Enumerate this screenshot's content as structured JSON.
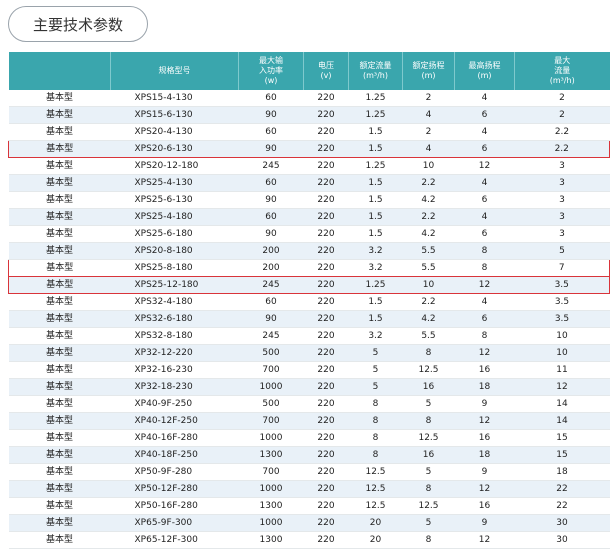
{
  "section_title": "主要技术参数",
  "table": {
    "headers": [
      "",
      "规格型号",
      "最大输入功率(w)",
      "电压(v)",
      "额定流量(m³/h)",
      "额定扬程(m)",
      "最高扬程(m)",
      "最大流量(m³/h)"
    ],
    "header_lines": [
      [
        ""
      ],
      [
        "规格型号"
      ],
      [
        "最大输",
        "入功率",
        "(w)"
      ],
      [
        "电压",
        "(v)"
      ],
      [
        "额定流量",
        "(m³/h)"
      ],
      [
        "额定扬程",
        "(m)"
      ],
      [
        "最高扬程",
        "(m)"
      ],
      [
        "最大",
        "流量",
        "(m³/h)"
      ]
    ],
    "highlight_color": "#d9343a",
    "rows": [
      {
        "cells": [
          "基本型",
          "XPS15-4-130",
          "60",
          "220",
          "1.25",
          "2",
          "4",
          "2"
        ],
        "highlight": false
      },
      {
        "cells": [
          "基本型",
          "XPS15-6-130",
          "90",
          "220",
          "1.25",
          "4",
          "6",
          "2"
        ],
        "highlight": false
      },
      {
        "cells": [
          "基本型",
          "XPS20-4-130",
          "60",
          "220",
          "1.5",
          "2",
          "4",
          "2.2"
        ],
        "highlight": false
      },
      {
        "cells": [
          "基本型",
          "XPS20-6-130",
          "90",
          "220",
          "1.5",
          "4",
          "6",
          "2.2"
        ],
        "highlight": true
      },
      {
        "cells": [
          "基本型",
          "XPS20-12-180",
          "245",
          "220",
          "1.25",
          "10",
          "12",
          "3"
        ],
        "highlight": false
      },
      {
        "cells": [
          "基本型",
          "XPS25-4-130",
          "60",
          "220",
          "1.5",
          "2.2",
          "4",
          "3"
        ],
        "highlight": false
      },
      {
        "cells": [
          "基本型",
          "XPS25-6-130",
          "90",
          "220",
          "1.5",
          "4.2",
          "6",
          "3"
        ],
        "highlight": false
      },
      {
        "cells": [
          "基本型",
          "XPS25-4-180",
          "60",
          "220",
          "1.5",
          "2.2",
          "4",
          "3"
        ],
        "highlight": false
      },
      {
        "cells": [
          "基本型",
          "XPS25-6-180",
          "90",
          "220",
          "1.5",
          "4.2",
          "6",
          "3"
        ],
        "highlight": false
      },
      {
        "cells": [
          "基本型",
          "XPS20-8-180",
          "200",
          "220",
          "3.2",
          "5.5",
          "8",
          "5"
        ],
        "highlight": false
      },
      {
        "cells": [
          "基本型",
          "XPS25-8-180",
          "200",
          "220",
          "3.2",
          "5.5",
          "8",
          "7"
        ],
        "highlight": true
      },
      {
        "cells": [
          "基本型",
          "XPS25-12-180",
          "245",
          "220",
          "1.25",
          "10",
          "12",
          "3.5"
        ],
        "highlight": true
      },
      {
        "cells": [
          "基本型",
          "XPS32-4-180",
          "60",
          "220",
          "1.5",
          "2.2",
          "4",
          "3.5"
        ],
        "highlight": false
      },
      {
        "cells": [
          "基本型",
          "XPS32-6-180",
          "90",
          "220",
          "1.5",
          "4.2",
          "6",
          "3.5"
        ],
        "highlight": false
      },
      {
        "cells": [
          "基本型",
          "XPS32-8-180",
          "245",
          "220",
          "3.2",
          "5.5",
          "8",
          "10"
        ],
        "highlight": false
      },
      {
        "cells": [
          "基本型",
          "XP32-12-220",
          "500",
          "220",
          "5",
          "8",
          "12",
          "10"
        ],
        "highlight": false
      },
      {
        "cells": [
          "基本型",
          "XP32-16-230",
          "700",
          "220",
          "5",
          "12.5",
          "16",
          "11"
        ],
        "highlight": false
      },
      {
        "cells": [
          "基本型",
          "XP32-18-230",
          "1000",
          "220",
          "5",
          "16",
          "18",
          "12"
        ],
        "highlight": false
      },
      {
        "cells": [
          "基本型",
          "XP40-9F-250",
          "500",
          "220",
          "8",
          "5",
          "9",
          "14"
        ],
        "highlight": false
      },
      {
        "cells": [
          "基本型",
          "XP40-12F-250",
          "700",
          "220",
          "8",
          "8",
          "12",
          "14"
        ],
        "highlight": false
      },
      {
        "cells": [
          "基本型",
          "XP40-16F-280",
          "1000",
          "220",
          "8",
          "12.5",
          "16",
          "15"
        ],
        "highlight": false
      },
      {
        "cells": [
          "基本型",
          "XP40-18F-250",
          "1300",
          "220",
          "8",
          "16",
          "18",
          "15"
        ],
        "highlight": false
      },
      {
        "cells": [
          "基本型",
          "XP50-9F-280",
          "700",
          "220",
          "12.5",
          "5",
          "9",
          "18"
        ],
        "highlight": false
      },
      {
        "cells": [
          "基本型",
          "XP50-12F-280",
          "1000",
          "220",
          "12.5",
          "8",
          "12",
          "22"
        ],
        "highlight": false
      },
      {
        "cells": [
          "基本型",
          "XP50-16F-280",
          "1300",
          "220",
          "12.5",
          "12.5",
          "16",
          "22"
        ],
        "highlight": false
      },
      {
        "cells": [
          "基本型",
          "XP65-9F-300",
          "1000",
          "220",
          "20",
          "5",
          "9",
          "30"
        ],
        "highlight": false
      },
      {
        "cells": [
          "基本型",
          "XP65-12F-300",
          "1300",
          "220",
          "20",
          "8",
          "12",
          "30"
        ],
        "highlight": false
      }
    ]
  }
}
